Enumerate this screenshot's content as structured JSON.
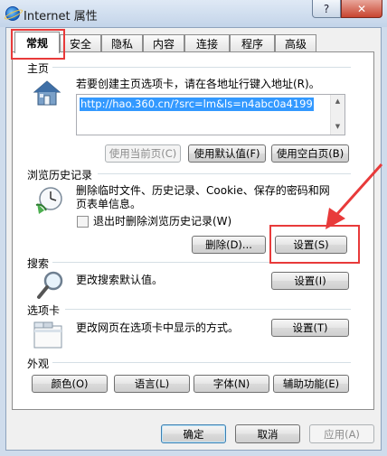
{
  "window": {
    "title": "Internet 属性",
    "help_glyph": "?",
    "close_glyph": "✕"
  },
  "tabs": [
    {
      "label": "常规",
      "active": true
    },
    {
      "label": "安全"
    },
    {
      "label": "隐私"
    },
    {
      "label": "内容"
    },
    {
      "label": "连接"
    },
    {
      "label": "程序"
    },
    {
      "label": "高级"
    }
  ],
  "home": {
    "section": "主页",
    "description": "若要创建主页选项卡，请在各地址行键入地址(R)。",
    "url": "http://hao.360.cn/?src=lm&ls=n4abc0a4199",
    "buttons": {
      "use_current": "使用当前页(C)",
      "use_default": "使用默认值(F)",
      "use_blank": "使用空白页(B)"
    }
  },
  "history": {
    "section": "浏览历史记录",
    "description": "删除临时文件、历史记录、Cookie、保存的密码和网页表单信息。",
    "checkbox_label": "退出时删除浏览历史记录(W)",
    "checkbox_checked": false,
    "buttons": {
      "delete": "删除(D)...",
      "settings": "设置(S)"
    }
  },
  "search": {
    "section": "搜索",
    "description": "更改搜索默认值。",
    "settings": "设置(I)"
  },
  "tabs_section": {
    "section": "选项卡",
    "description": "更改网页在选项卡中显示的方式。",
    "settings": "设置(T)"
  },
  "appearance": {
    "section": "外观",
    "buttons": {
      "colors": "颜色(O)",
      "languages": "语言(L)",
      "fonts": "字体(N)",
      "accessibility": "辅助功能(E)"
    }
  },
  "footer": {
    "ok": "确定",
    "cancel": "取消",
    "apply": "应用(A)"
  },
  "annotation_color": "#e83a3a"
}
